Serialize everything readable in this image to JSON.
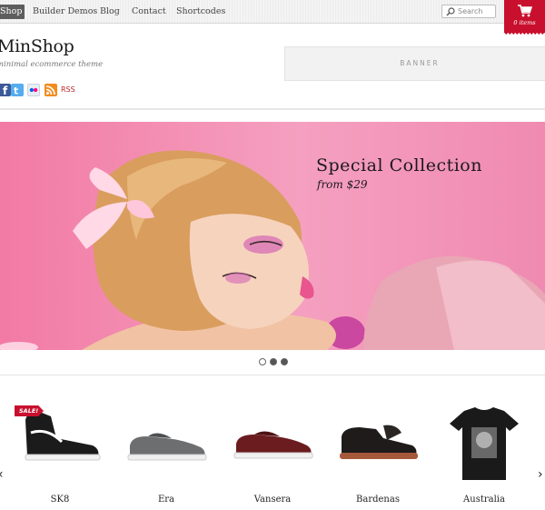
{
  "nav": {
    "items": [
      {
        "label": "Shop",
        "active": true
      },
      {
        "label": "Builder Demos",
        "active": false
      },
      {
        "label": "Blog",
        "active": false
      },
      {
        "label": "Contact",
        "active": false
      },
      {
        "label": "Shortcodes",
        "active": false
      }
    ],
    "search_placeholder": "Search",
    "cart_label": "0 items"
  },
  "header": {
    "site_title": "MinShop",
    "tagline": "minimal ecommerce theme",
    "social": [
      {
        "icon": "facebook-icon"
      },
      {
        "icon": "twitter-icon"
      },
      {
        "icon": "flickr-icon"
      },
      {
        "icon": "rss-icon"
      }
    ],
    "rss_label": "RSS",
    "banner_label": "BANNER"
  },
  "slider": {
    "title": "Special Collection",
    "subtitle": "from $29",
    "dots": 3,
    "active_dot": 1
  },
  "products": {
    "sale_label": "SALE!",
    "items": [
      {
        "name": "SK8",
        "sale": true
      },
      {
        "name": "Era",
        "sale": false
      },
      {
        "name": "Vansera",
        "sale": false
      },
      {
        "name": "Bardenas",
        "sale": false
      },
      {
        "name": "Australia",
        "sale": false
      }
    ],
    "prev_icon": "chevron-left-icon",
    "next_icon": "chevron-right-icon"
  },
  "colors": {
    "accent": "#c8102e",
    "slider_bg": "#f27aa4",
    "nav_active": "#5d5d5d"
  }
}
